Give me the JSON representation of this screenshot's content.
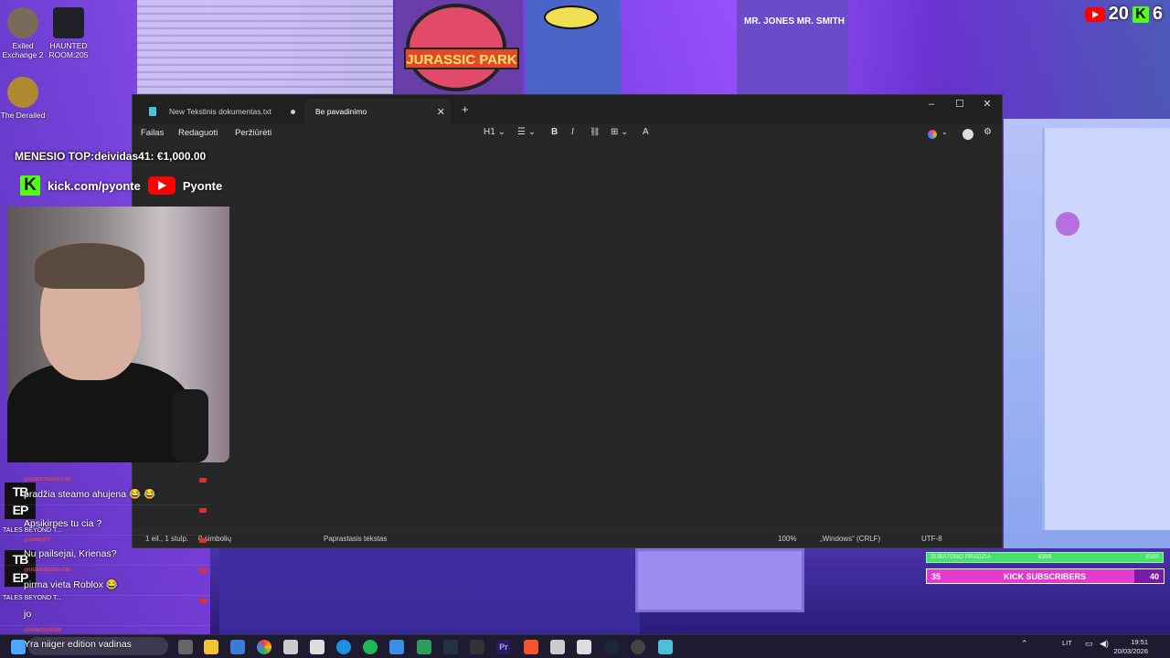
{
  "desktop": {
    "icons": [
      {
        "label_line1": "Exiled",
        "label_line2": "Exchange 2",
        "color": "#7a6a58"
      },
      {
        "label_line1": "HAUNTED",
        "label_line2": "ROOM:205",
        "color": "#202028"
      },
      {
        "label_line1": "The Derailed",
        "label_line2": "",
        "color": "#b08a30"
      }
    ]
  },
  "counters": {
    "youtube": "20",
    "kick": "6"
  },
  "posters": {
    "jp": "JURASSIC PARK",
    "mib": "MR. JONES  MR. SMITH"
  },
  "notepad": {
    "tabs": [
      {
        "label": "New Tekstinis dokumentas.txt",
        "unsaved": true
      },
      {
        "label": "Be pavadinimo",
        "active": true
      }
    ],
    "window_controls": {
      "minimize": "–",
      "maximize": "☐",
      "close": "✕"
    },
    "menu": {
      "file": "Failas",
      "edit": "Redaguoti",
      "view": "Peržiūrėti"
    },
    "toolbar": {
      "heading": "H1",
      "list": "☰",
      "bold": "B",
      "italic": "I",
      "link": "🔗",
      "table": "⊞",
      "format": "A"
    },
    "status": {
      "position": "1 eil., 1 stulp.",
      "chars": "0 simbolių",
      "format": "Paprastasis tekstas",
      "zoom": "100%",
      "eol": "„Windows“ (CRLF)",
      "encoding": "UTF-8"
    }
  },
  "overlay": {
    "top_donor": "MENESIO TOP:deividas41: €1,000.00",
    "kick_url": "kick.com/pyonte",
    "youtube_name": "Pyonte"
  },
  "chat": [
    {
      "user": "@UGNIUSUGN-V3K",
      "text": "pradžia steamo ahujena 😂 😂"
    },
    {
      "user": "",
      "text": "Apsikirpes tu cia ?"
    },
    {
      "user": "@JAMQZY",
      "text": "Nu pailsejai, Krienas?"
    },
    {
      "user": "@UGNIUSUGN-V3K",
      "text": "pirma vieta Roblox 😂"
    },
    {
      "user": "",
      "text": "jo"
    },
    {
      "user": "@MANTAS9369",
      "text": "Yra niiger edition vadinas"
    }
  ],
  "sidebar_games": [
    {
      "abbr": "TB EP",
      "caption": "TALES BEYOND T..."
    },
    {
      "abbr": "TB EP",
      "caption": "TALES BEYOND T..."
    }
  ],
  "goals": {
    "sub_goal_label": "SUBATONO PRADZIA",
    "sub_goal_mid": "€986",
    "sub_goal_right": "€500",
    "kick_subs_label": "KICK SUBSCRIBERS",
    "kick_subs_current": "35",
    "kick_subs_target": "40"
  },
  "taskbar": {
    "lang": "LIT",
    "time": "19:51",
    "date": "20/03/2026"
  },
  "colors": {
    "kick": "#53fc18",
    "youtube": "#ff0000",
    "notepad_bg": "#272727"
  }
}
